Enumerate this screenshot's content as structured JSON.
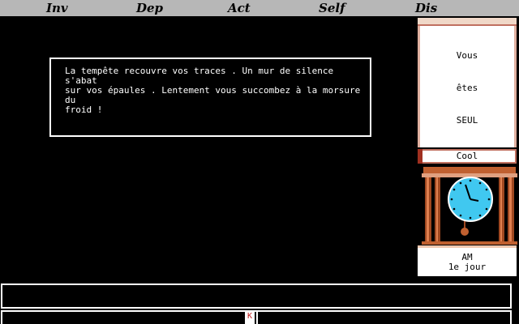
{
  "menu": {
    "items": [
      {
        "label": "Inv"
      },
      {
        "label": "Dep"
      },
      {
        "label": "Act"
      },
      {
        "label": "Self"
      },
      {
        "label": "Dis"
      }
    ]
  },
  "message": {
    "text": "La tempête recouvre vos traces . Un mur de silence s'abat\nsur vos épaules . Lentement vous succombez à la morsure du\nfroid !"
  },
  "scroll": {
    "words": [
      "Vous",
      "êtes",
      "SEUL"
    ]
  },
  "status": {
    "label": "Cool"
  },
  "time": {
    "period": "AM",
    "day": "1e jour"
  },
  "input": {
    "marker": "K"
  },
  "colors": {
    "menubar": "#b7b7b7",
    "clock_face": "#40c8f0",
    "clock_case": "#a04820",
    "scroll_trim": "#c07060"
  }
}
